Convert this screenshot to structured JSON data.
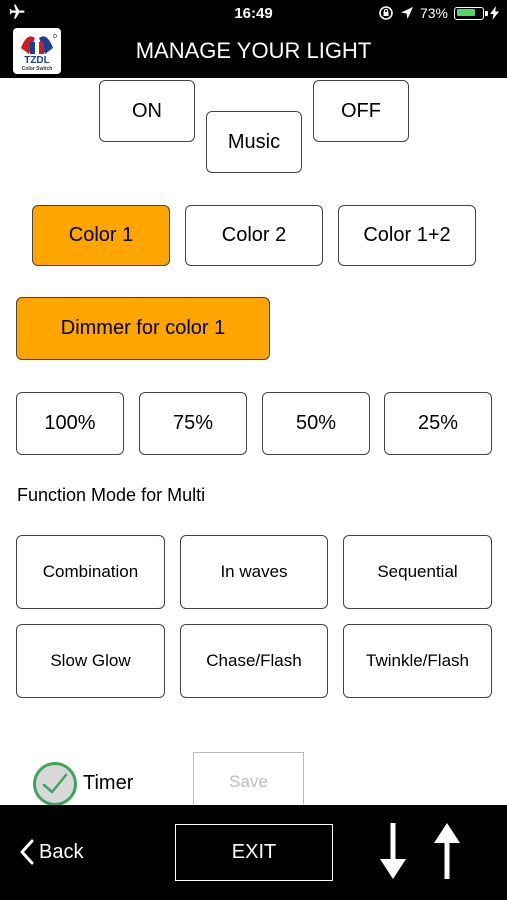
{
  "status_bar": {
    "time": "16:49",
    "battery": "73%",
    "battery_level": 0.73,
    "battery_color": "#4cd964"
  },
  "header": {
    "title": "MANAGE YOUR LIGHT",
    "logo_text": "TZDL",
    "logo_subtext": "Color Switch"
  },
  "power": {
    "on_label": "ON",
    "music_label": "Music",
    "off_label": "OFF"
  },
  "color_select": {
    "color1_label": "Color 1",
    "color2_label": "Color 2",
    "color12_label": "Color 1+2",
    "active": "Color 1"
  },
  "dimmer": {
    "label": "Dimmer for color 1",
    "levels": [
      "100%",
      "75%",
      "50%",
      "25%"
    ]
  },
  "function_mode": {
    "title": "Function Mode for Multi",
    "modes": [
      "Combination",
      "In waves",
      "Sequential",
      "Slow Glow",
      "Chase/Flash",
      "Twinkle/Flash"
    ]
  },
  "timer": {
    "label": "Timer",
    "checked": true,
    "save_label": "Save"
  },
  "bottom_bar": {
    "back_label": "Back",
    "exit_label": "EXIT",
    "down_icon": "arrow-down-icon",
    "up_icon": "arrow-up-icon"
  },
  "colors": {
    "accent": "#ffa500",
    "bar_bg": "#000000",
    "check_green": "#3ea35f"
  }
}
